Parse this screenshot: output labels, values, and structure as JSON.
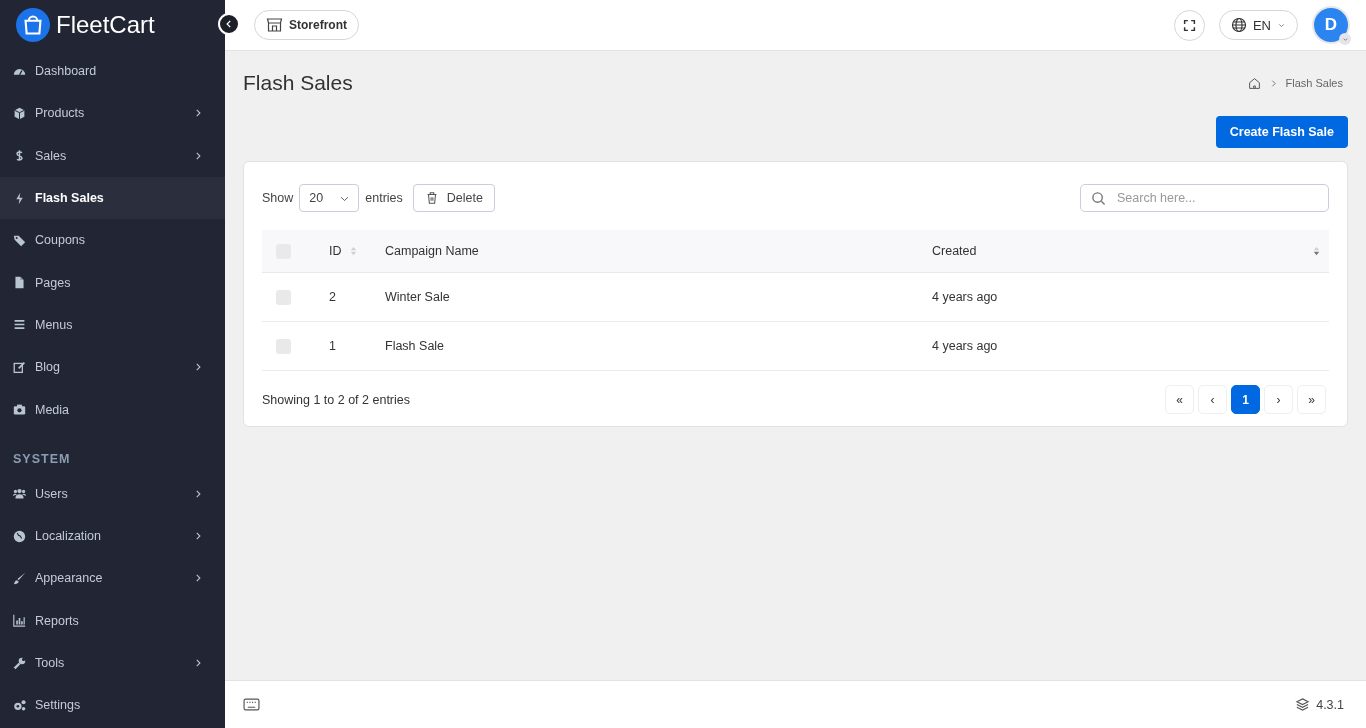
{
  "brand": {
    "name": "FleetCart"
  },
  "sidebar": {
    "groups": [
      {
        "items": [
          {
            "label": "Dashboard",
            "expandable": false,
            "selected": false
          },
          {
            "label": "Products",
            "expandable": true,
            "selected": false
          },
          {
            "label": "Sales",
            "expandable": true,
            "selected": false
          },
          {
            "label": "Flash Sales",
            "expandable": false,
            "selected": true
          },
          {
            "label": "Coupons",
            "expandable": false,
            "selected": false
          },
          {
            "label": "Pages",
            "expandable": false,
            "selected": false
          },
          {
            "label": "Menus",
            "expandable": false,
            "selected": false
          },
          {
            "label": "Blog",
            "expandable": true,
            "selected": false
          },
          {
            "label": "Media",
            "expandable": false,
            "selected": false
          }
        ]
      },
      {
        "heading": "SYSTEM",
        "items": [
          {
            "label": "Users",
            "expandable": true,
            "selected": false
          },
          {
            "label": "Localization",
            "expandable": true,
            "selected": false
          },
          {
            "label": "Appearance",
            "expandable": true,
            "selected": false
          },
          {
            "label": "Reports",
            "expandable": false,
            "selected": false
          },
          {
            "label": "Tools",
            "expandable": true,
            "selected": false
          },
          {
            "label": "Settings",
            "expandable": false,
            "selected": false
          }
        ]
      }
    ]
  },
  "topbar": {
    "storefront": "Storefront",
    "language": "EN",
    "avatar": "D"
  },
  "page": {
    "title": "Flash Sales",
    "breadcrumb": [
      "Flash Sales"
    ],
    "create_button": "Create Flash Sale"
  },
  "table_controls": {
    "show_label": "Show",
    "page_size": "20",
    "entries_label": "entries",
    "delete_button": "Delete",
    "search": {
      "placeholder": "Search here..."
    }
  },
  "table": {
    "select_all": {
      "checked": false
    },
    "columns": [
      {
        "label": "ID",
        "sortable": true,
        "sorted": false
      },
      {
        "label": "Campaign Name",
        "sortable": false
      },
      {
        "label": "Created",
        "sortable": true,
        "sorted": true
      }
    ],
    "rows": [
      {
        "checked": false,
        "cells": [
          "2",
          "Winter Sale",
          "4 years ago"
        ]
      },
      {
        "checked": false,
        "cells": [
          "1",
          "Flash Sale",
          "4 years ago"
        ]
      }
    ]
  },
  "summary": "Showing 1 to 2 of 2 entries",
  "pagination": [
    {
      "label": "«",
      "selected": false
    },
    {
      "label": "‹",
      "selected": false
    },
    {
      "label": "1",
      "selected": true
    },
    {
      "label": "›",
      "selected": false
    },
    {
      "label": "»",
      "selected": false
    }
  ],
  "footer": {
    "version": "4.3.1"
  }
}
